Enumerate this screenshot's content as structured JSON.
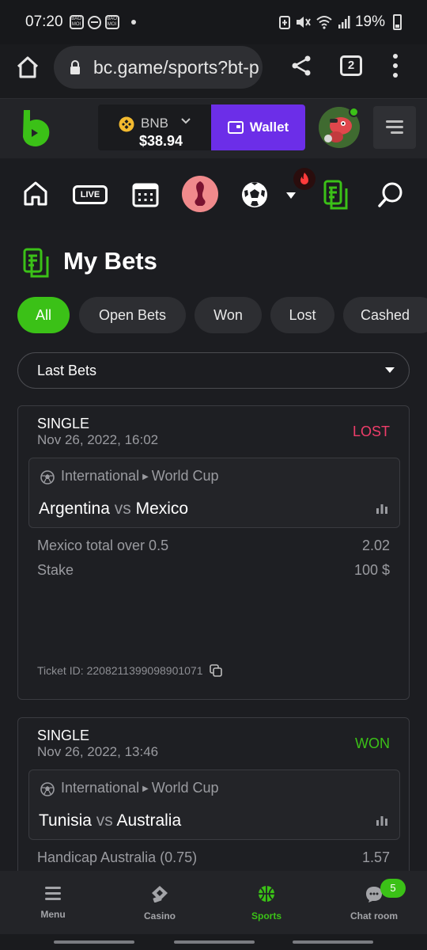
{
  "status_bar": {
    "time": "07:20",
    "battery": "19%",
    "icons": [
      "news-icon",
      "dnd-icon",
      "news-icon",
      "battery-saver-icon",
      "mute-icon",
      "wifi-icon",
      "signal-icon",
      "battery-icon"
    ]
  },
  "browser": {
    "url": "bc.game/sports?bt-p",
    "tab_count": "2"
  },
  "site_header": {
    "currency": "BNB",
    "balance": "$38.94",
    "wallet_label": "Wallet"
  },
  "sport_nav": {
    "live_label": "LIVE",
    "items": [
      "home-icon",
      "live-icon",
      "calendar-icon",
      "world-cup-icon",
      "soccer-ball-icon",
      "my-bets-icon",
      "search-icon"
    ]
  },
  "page": {
    "title": "My Bets"
  },
  "filters": {
    "chips": [
      "All",
      "Open Bets",
      "Won",
      "Lost",
      "Cashed"
    ],
    "active": "All",
    "dropdown_value": "Last Bets"
  },
  "bets": [
    {
      "type": "SINGLE",
      "date": "Nov 26, 2022, 16:02",
      "status": "LOST",
      "category": "International",
      "tournament": "World Cup",
      "home": "Argentina",
      "vs": "vs",
      "away": "Mexico",
      "selection": "Mexico total over 0.5",
      "odds": "2.02",
      "stake_label": "Stake",
      "stake": "100 $",
      "ticket_label": "Ticket ID:",
      "ticket_id": "2208211399098901071"
    },
    {
      "type": "SINGLE",
      "date": "Nov 26, 2022, 13:46",
      "status": "WON",
      "category": "International",
      "tournament": "World Cup",
      "home": "Tunisia",
      "vs": "vs",
      "away": "Australia",
      "selection": "Handicap Australia (0.75)",
      "odds": "1.57"
    }
  ],
  "bottom_nav": {
    "items": [
      {
        "label": "Menu",
        "icon": "menu-icon"
      },
      {
        "label": "Casino",
        "icon": "casino-icon"
      },
      {
        "label": "Sports",
        "icon": "sports-icon"
      },
      {
        "label": "Chat room",
        "icon": "chat-icon"
      }
    ],
    "chat_badge": "5"
  },
  "colors": {
    "accent_green": "#3bc117",
    "wallet_purple": "#6c2ee8",
    "lost_pink": "#ef3d6a"
  }
}
